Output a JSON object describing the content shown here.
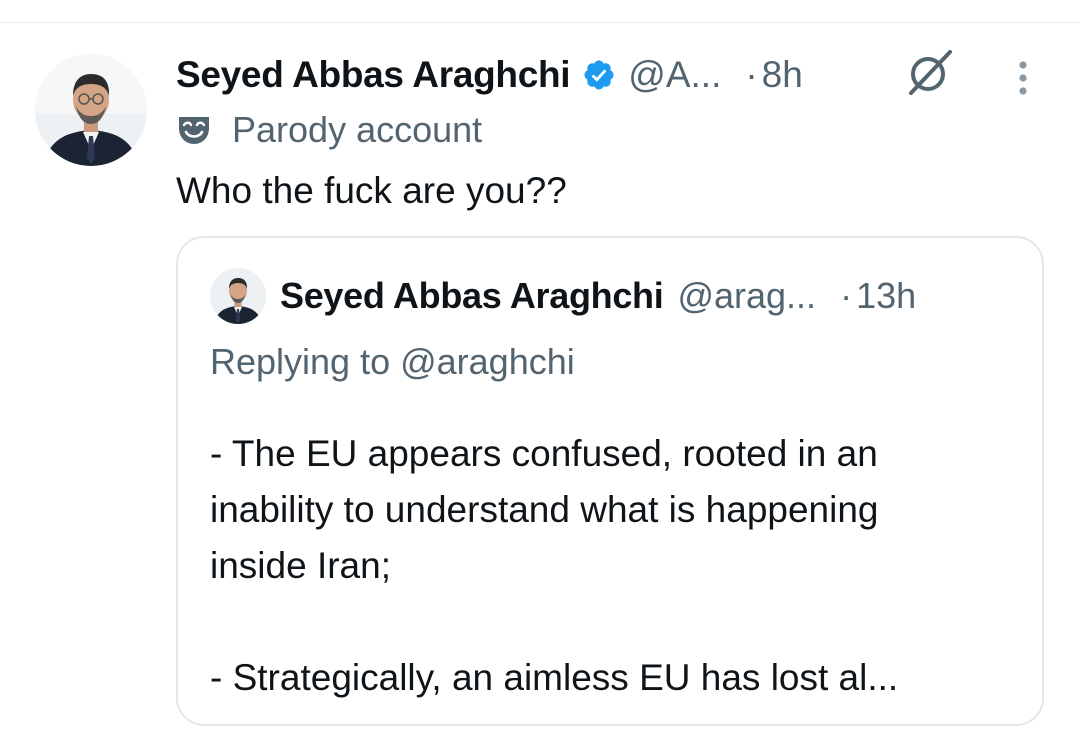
{
  "tweet": {
    "author_name": "Seyed Abbas Araghchi",
    "handle": "@A...",
    "separator": "·",
    "time": "8h",
    "parody_label": "Parody account",
    "text": "Who the fuck are you??"
  },
  "quoted_tweet": {
    "author_name": "Seyed Abbas Araghchi",
    "handle": "@arag...",
    "separator": "·",
    "time": "13h",
    "replying_to": "Replying to @araghchi",
    "lines": [
      "- The EU appears confused, rooted in an",
      "inability to understand what is happening",
      "inside Iran;",
      "- Strategically, an aimless EU has lost al..."
    ]
  },
  "icons": {
    "verified": "verified-badge-icon",
    "grok": "grok-icon",
    "more": "more-options-icon",
    "parody": "parody-mask-icon"
  },
  "colors": {
    "primary_text": "#0f1419",
    "secondary_text": "#536471",
    "verified_blue": "#1d9bf0",
    "border": "#e2e8ec"
  }
}
